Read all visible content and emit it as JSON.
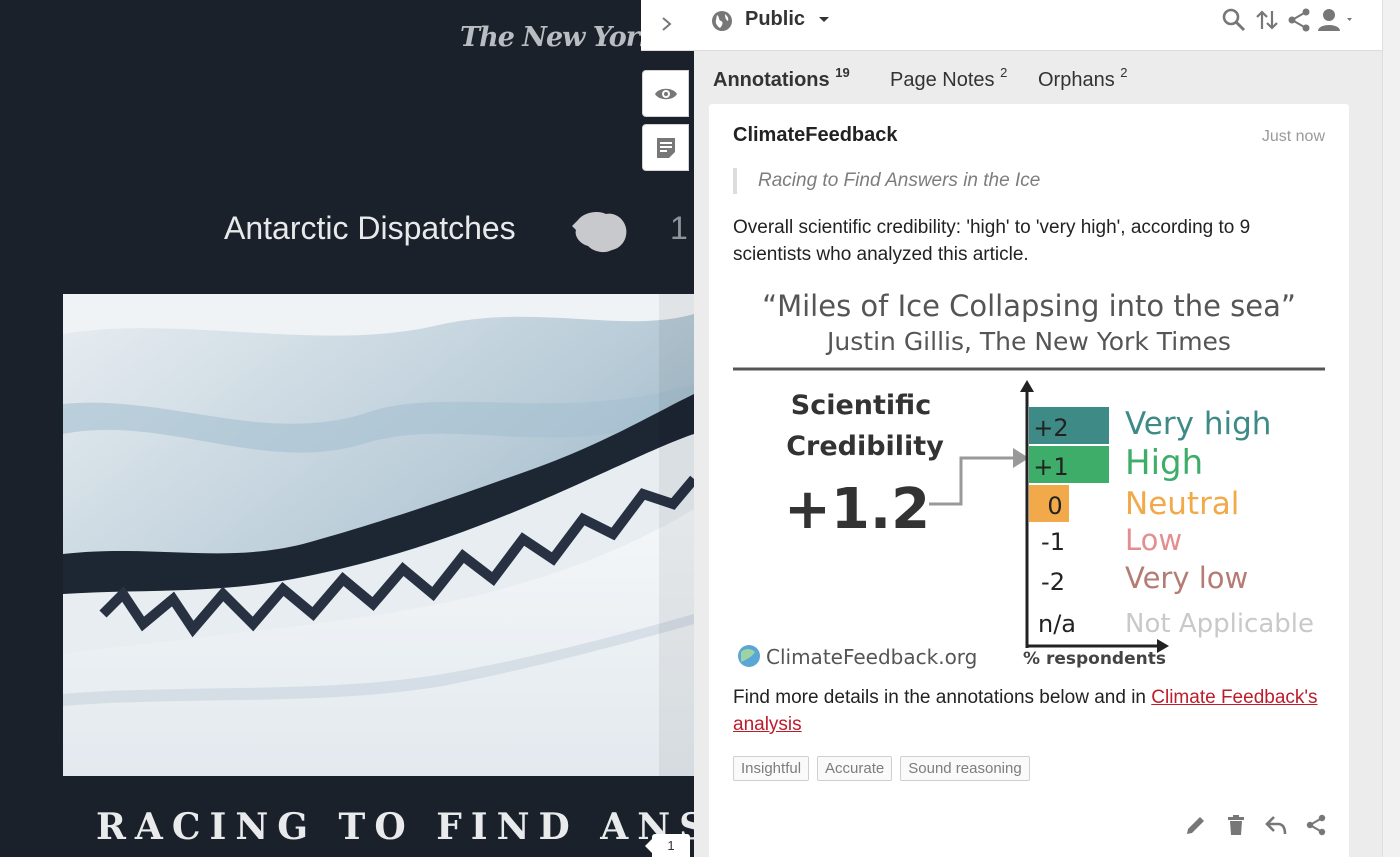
{
  "article": {
    "publication": "The New York Times",
    "series_title": "Antarctic Dispatches",
    "series_number": "1",
    "headline": "RACING TO FIND ANSW",
    "annotation_badge": "1"
  },
  "topbar": {
    "group_name": "Public",
    "icons": [
      "chevron-right-icon",
      "globe-icon",
      "search-icon",
      "sort-icon",
      "share-icon",
      "user-icon"
    ]
  },
  "tabs": [
    {
      "label": "Annotations",
      "count": "19"
    },
    {
      "label": "Page Notes",
      "count": "2"
    },
    {
      "label": "Orphans",
      "count": "2"
    }
  ],
  "annotation": {
    "user": "ClimateFeedback",
    "time": "Just now",
    "quote": "Racing to Find Answers in the Ice",
    "body": "Overall scientific credibility: 'high' to 'very high', according to 9 scientists who analyzed this article.",
    "figure": {
      "title_line1": "“Miles of Ice Collapsing into the sea”",
      "title_line2": "Justin Gillis, The New York Times",
      "score_label_1": "Scientific",
      "score_label_2": "Credibility",
      "score": "+1.2",
      "scale": [
        {
          "value": "+2",
          "label": "Very high",
          "color": "#3d8a86"
        },
        {
          "value": "+1",
          "label": "High",
          "color": "#3fad6a"
        },
        {
          "value": "0",
          "label": "Neutral",
          "color": "#f2a94a"
        },
        {
          "value": "-1",
          "label": "Low",
          "color": "#e38f8f"
        },
        {
          "value": "-2",
          "label": "Very low",
          "color": "#b57b74"
        },
        {
          "value": "n/a",
          "label": "Not Applicable",
          "color": "#c9c9c9"
        }
      ],
      "source": "ClimateFeedback.org",
      "x_axis": "% respondents"
    },
    "footer_text": "Find more details in the annotations below and in ",
    "footer_link": "Climate Feedback's analysis",
    "tags": [
      "Insightful",
      "Accurate",
      "Sound reasoning"
    ]
  }
}
